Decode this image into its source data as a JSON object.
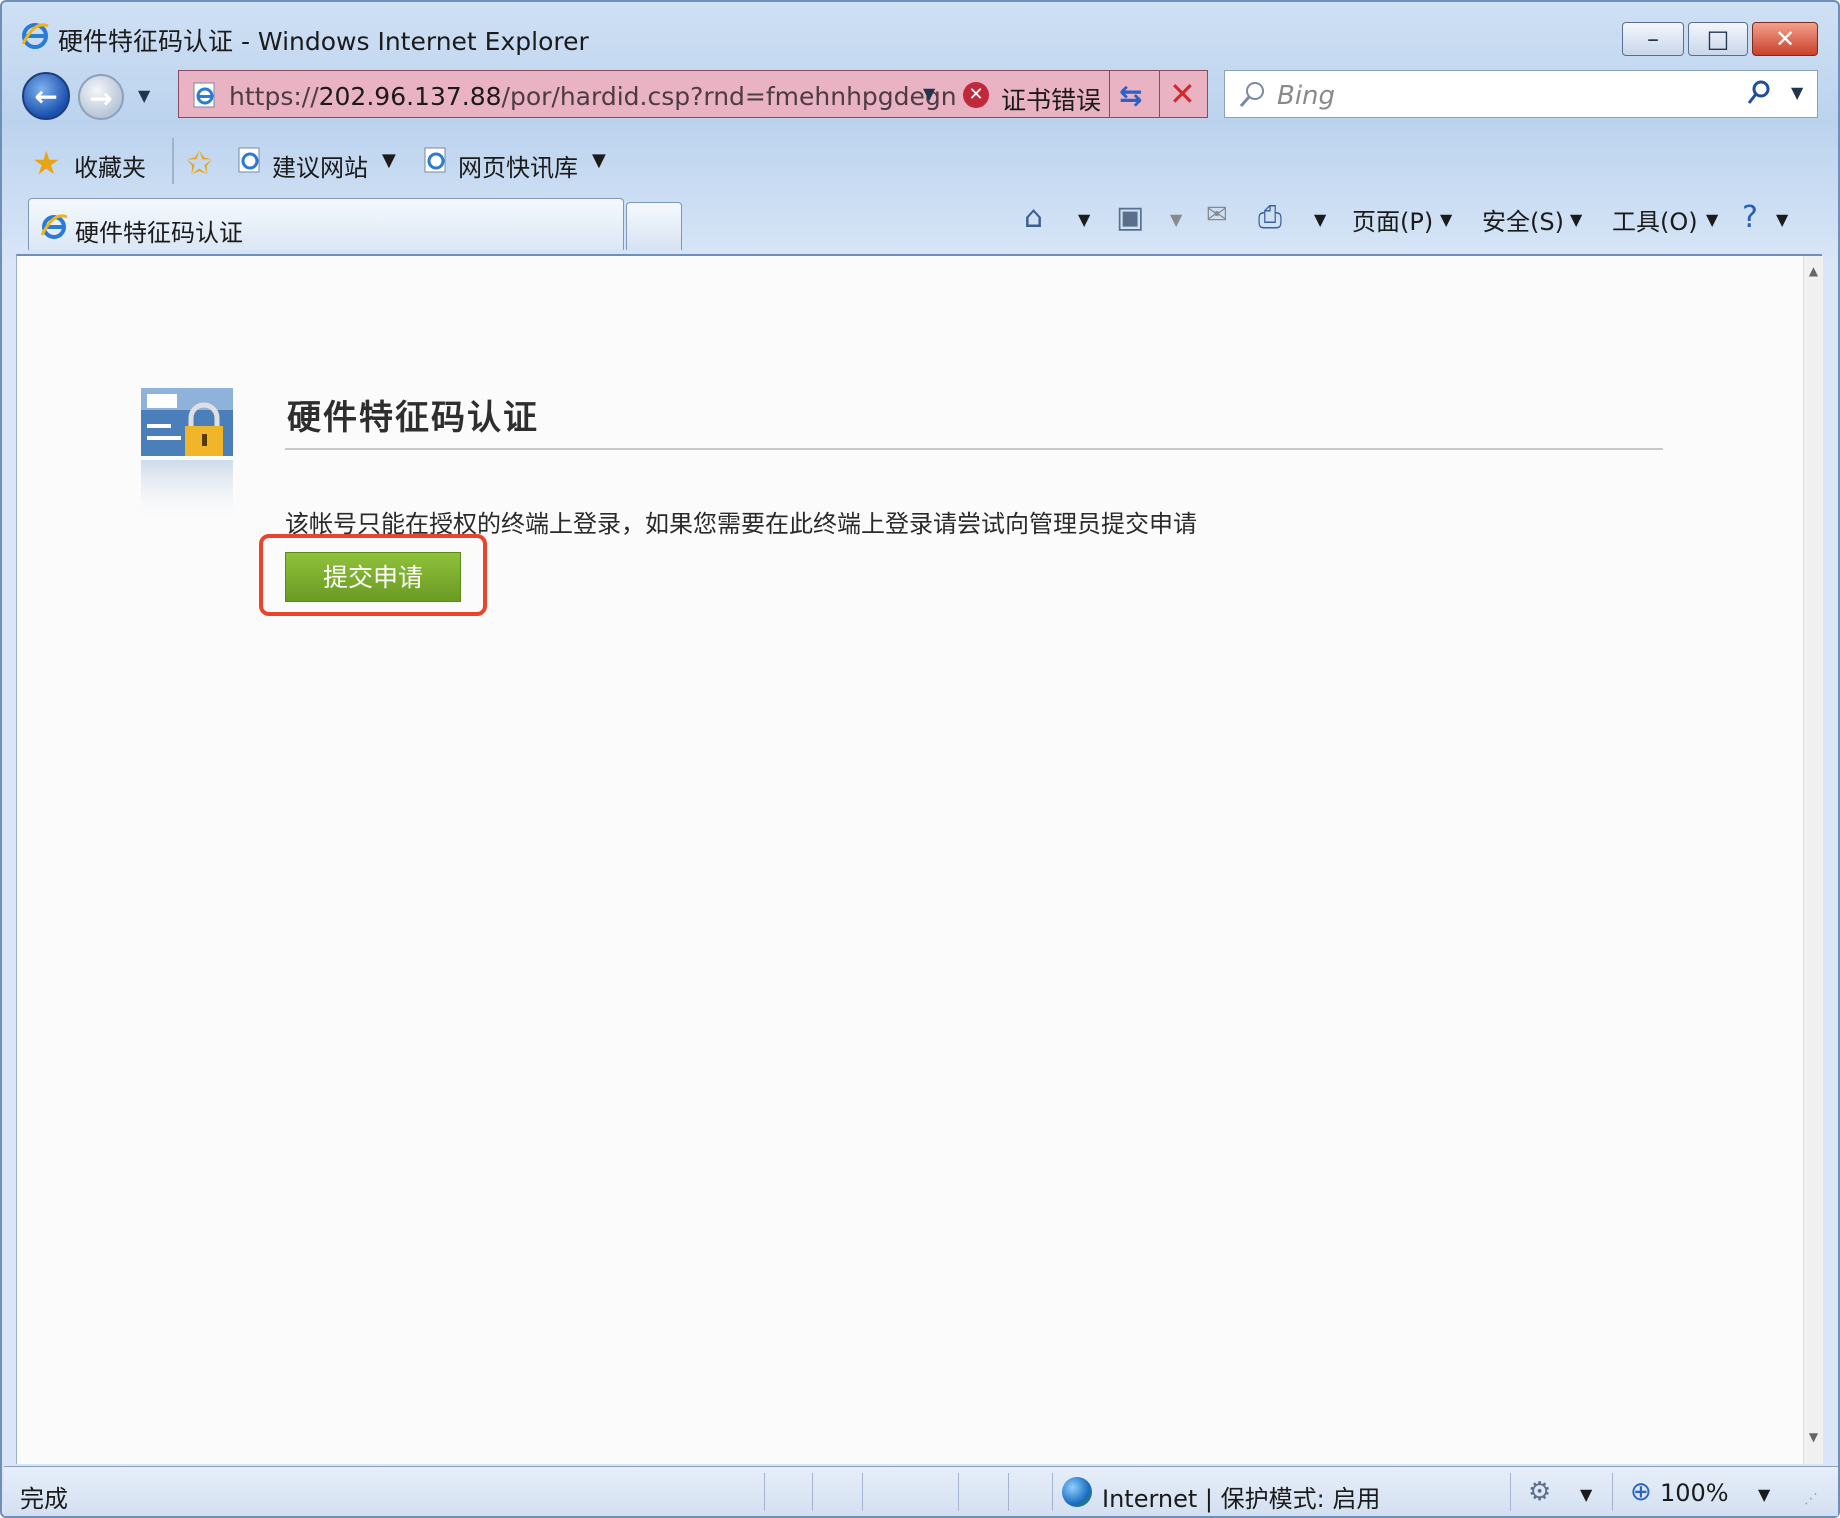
{
  "window": {
    "title": "硬件特征码认证 - Windows Internet Explorer",
    "controls": {
      "minimize": "–",
      "maximize": "□",
      "close": "✕"
    }
  },
  "address": {
    "url_prefix": "https://",
    "url_host": "202.96.137.88",
    "url_rest": "/por/hardid.csp?rnd=fmehnhpgdegn",
    "cert_error": "证书错误",
    "search_placeholder": "Bing"
  },
  "favorites": {
    "label": "收藏夹",
    "links": [
      "建议网站",
      "网页快讯库"
    ]
  },
  "tab": {
    "label": "硬件特征码认证"
  },
  "commands": {
    "page": "页面(P)",
    "safety": "安全(S)",
    "tools": "工具(O)"
  },
  "content": {
    "heading": "硬件特征码认证",
    "notice": "该帐号只能在授权的终端上登录，如果您需要在此终端上登录请尝试向管理员提交申请",
    "submit_label": "提交申请"
  },
  "status": {
    "done": "完成",
    "zone": "Internet | 保护模式: 启用",
    "zoom": "100%"
  },
  "colors": {
    "address_error_bg": "#eab3c4",
    "submit_green": "#7aab2c",
    "highlight_red": "#e8442e"
  },
  "icons": {
    "title": "ie-logo-icon",
    "cert": "cert-error-shield-icon",
    "auth": "card-lock-icon"
  }
}
